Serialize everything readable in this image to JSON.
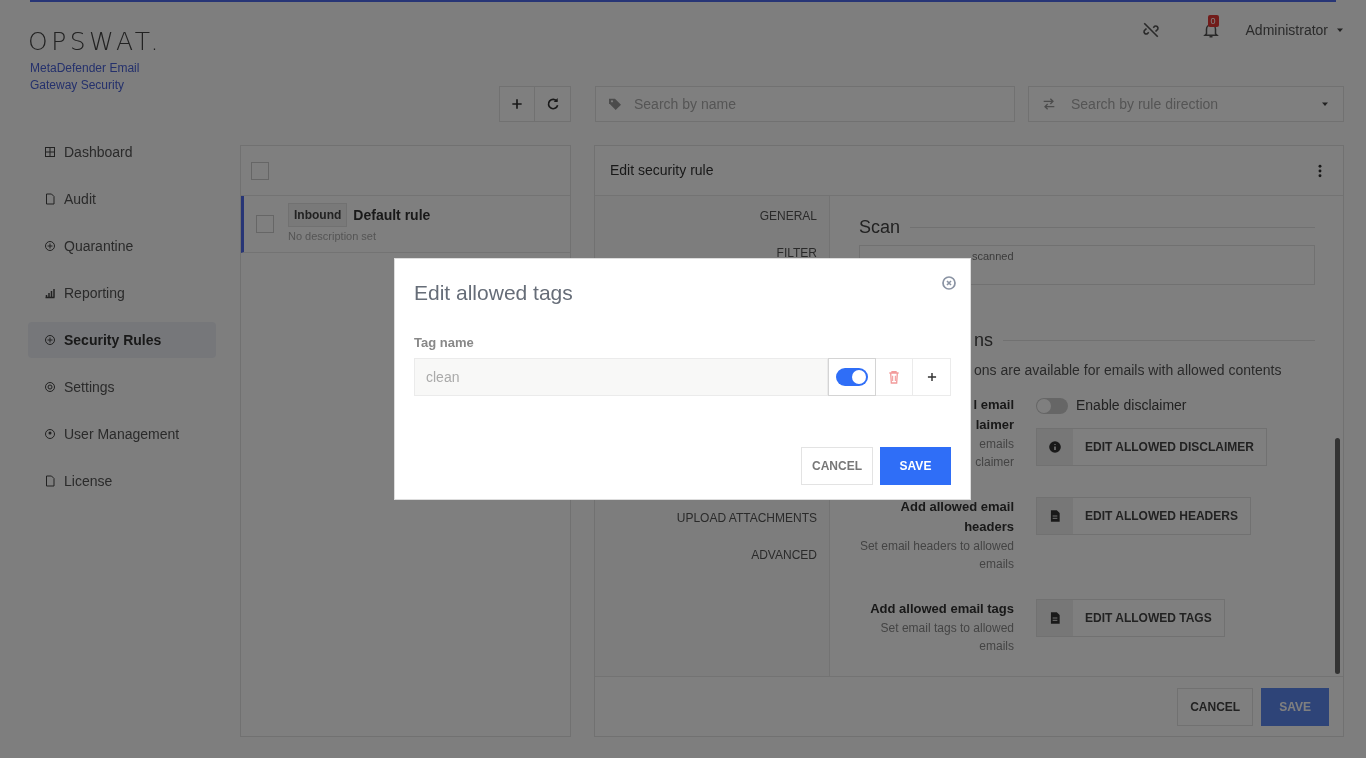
{
  "header": {
    "logo": "OPSWAT.",
    "product": "MetaDefender Email Gateway Security",
    "notification_count": "0",
    "user": "Administrator"
  },
  "sidebar": {
    "items": [
      {
        "label": "Dashboard",
        "selected": false
      },
      {
        "label": "Audit",
        "selected": false
      },
      {
        "label": "Quarantine",
        "selected": false
      },
      {
        "label": "Reporting",
        "selected": false
      },
      {
        "label": "Security Rules",
        "selected": true
      },
      {
        "label": "Settings",
        "selected": false
      },
      {
        "label": "User Management",
        "selected": false
      },
      {
        "label": "License",
        "selected": false
      }
    ]
  },
  "toolbar": {
    "search_placeholder": "Search by name",
    "direction_placeholder": "Search by rule direction"
  },
  "rules_list": {
    "select_all_checked": false,
    "rows": [
      {
        "direction": "Inbound",
        "name": "Default rule",
        "description": "No description set",
        "selected": true,
        "checked": false
      }
    ]
  },
  "editor": {
    "title": "Edit security rule",
    "nav_upper": [
      {
        "label": "GENERAL"
      },
      {
        "label": "FILTER"
      }
    ],
    "nav_lower": [
      {
        "label": "UPLOAD ATTACHMENTS"
      },
      {
        "label": "ADVANCED"
      }
    ],
    "scan": {
      "legend": "Scan",
      "value": "scanned"
    },
    "actions": {
      "heading": "ns",
      "note": "ons are available for emails with allowed contents",
      "rows": [
        {
          "kind": "toggle",
          "title": [
            "l email",
            "laimer"
          ],
          "description": [
            "emails",
            "claimer"
          ],
          "toggle_label": "Enable disclaimer",
          "on": false,
          "button": "EDIT ALLOWED DISCLAIMER"
        },
        {
          "kind": "document",
          "title": [
            "Add allowed email headers"
          ],
          "description": [
            "Set email headers to allowed emails"
          ],
          "button": "EDIT ALLOWED HEADERS"
        },
        {
          "kind": "document",
          "title": [
            "Add allowed email tags"
          ],
          "description": [
            "Set email tags to allowed emails"
          ],
          "button": "EDIT ALLOWED TAGS"
        }
      ]
    },
    "footer_buttons": [
      "CANCEL",
      "SAVE"
    ]
  },
  "dialog": {
    "title": "Edit allowed tags",
    "field_label": "Tag name",
    "tags": [
      {
        "value": "clean",
        "enabled": true
      }
    ],
    "buttons": [
      "CANCEL",
      "SAVE"
    ]
  }
}
